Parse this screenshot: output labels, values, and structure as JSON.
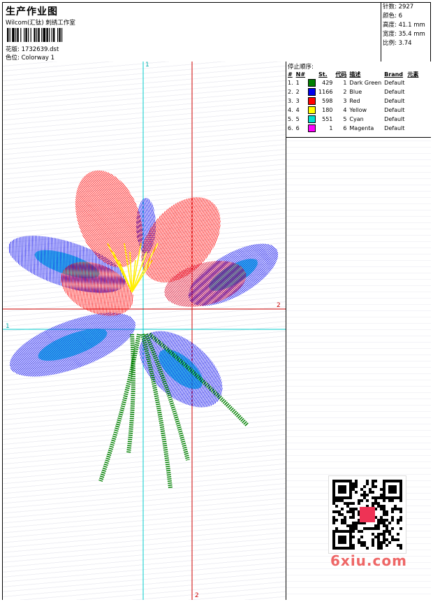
{
  "header": {
    "title": "生产作业图",
    "company": "Wilcom(汇钛) 刺绣工作室",
    "design_label": "花版:",
    "design_value": "1732639.dst",
    "colorway_label": "色位:",
    "colorway_value": "Colorway 1"
  },
  "stats": [
    {
      "label": "针数:",
      "value": "2927"
    },
    {
      "label": "颜色:",
      "value": "6"
    },
    {
      "label": "高度:",
      "value": "41.1 mm"
    },
    {
      "label": "宽度:",
      "value": "35.4 mm"
    },
    {
      "label": "比例:",
      "value": "3.74"
    }
  ],
  "stop_sequence": {
    "label": "停止顺序:",
    "columns": [
      "#",
      "N#",
      "St.",
      "代码",
      "描述",
      "Brand",
      "元素"
    ],
    "rows": [
      {
        "idx": "1.",
        "n": "1",
        "color": "#008000",
        "st": "429",
        "code": "1",
        "desc": "Dark Green",
        "brand": "Default"
      },
      {
        "idx": "2.",
        "n": "2",
        "color": "#0000ee",
        "st": "1166",
        "code": "2",
        "desc": "Blue",
        "brand": "Default"
      },
      {
        "idx": "3.",
        "n": "3",
        "color": "#ff0000",
        "st": "598",
        "code": "3",
        "desc": "Red",
        "brand": "Default"
      },
      {
        "idx": "4.",
        "n": "4",
        "color": "#ffff00",
        "st": "180",
        "code": "4",
        "desc": "Yellow",
        "brand": "Default"
      },
      {
        "idx": "5.",
        "n": "5",
        "color": "#00e0d0",
        "st": "551",
        "code": "5",
        "desc": "Cyan",
        "brand": "Default"
      },
      {
        "idx": "6.",
        "n": "6",
        "color": "#ff00ff",
        "st": "1",
        "code": "6",
        "desc": "Magenta",
        "brand": "Default"
      }
    ]
  },
  "axes": {
    "v1": "1",
    "v2": "2",
    "h1": "1",
    "h2": "2"
  },
  "watermark": "6xiu.com",
  "colors": {
    "red_axis": "#cc0000",
    "cyan_axis": "#00cccc"
  }
}
